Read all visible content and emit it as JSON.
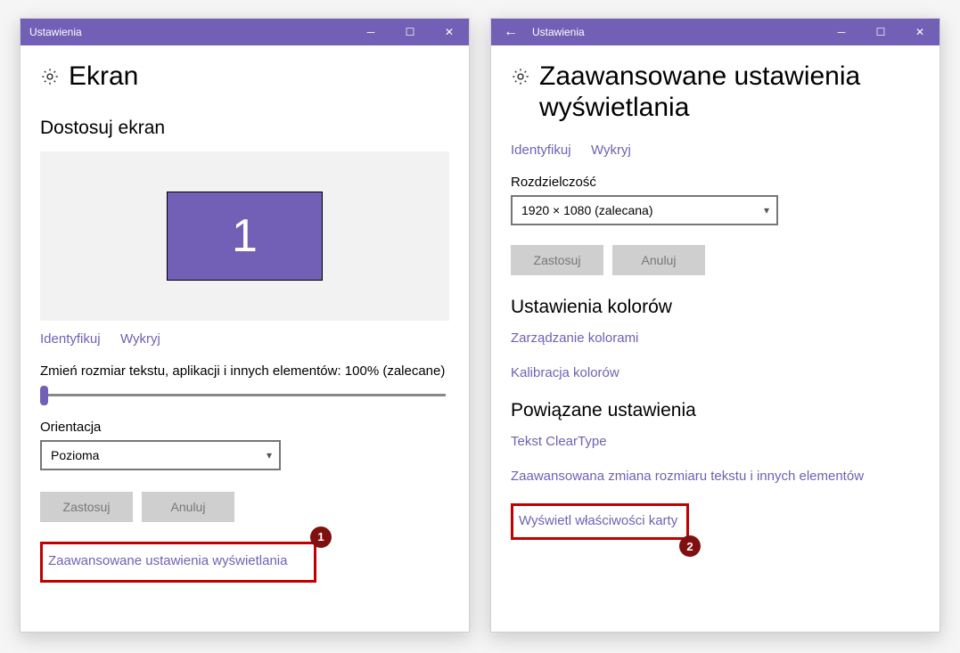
{
  "accent": "#7160b5",
  "left": {
    "titlebar": "Ustawienia",
    "page_title": "Ekran",
    "subhead": "Dostosuj ekran",
    "monitor_number": "1",
    "identify": "Identyfikuj",
    "detect": "Wykryj",
    "scale_text": "Zmień rozmiar tekstu, aplikacji i innych elementów: 100% (zalecane)",
    "orientation_label": "Orientacja",
    "orientation_value": "Pozioma",
    "apply": "Zastosuj",
    "cancel": "Anuluj",
    "advanced_link": "Zaawansowane ustawienia wyświetlania",
    "badge1": "1"
  },
  "right": {
    "titlebar": "Ustawienia",
    "page_title": "Zaawansowane ustawienia wyświetlania",
    "identify": "Identyfikuj",
    "detect": "Wykryj",
    "resolution_label": "Rozdzielczość",
    "resolution_value": "1920 × 1080 (zalecana)",
    "apply": "Zastosuj",
    "cancel": "Anuluj",
    "color_head": "Ustawienia kolorów",
    "color_manage": "Zarządzanie kolorami",
    "color_calib": "Kalibracja kolorów",
    "related_head": "Powiązane ustawienia",
    "cleartype": "Tekst ClearType",
    "adv_text_sizing": "Zaawansowana zmiana rozmiaru tekstu i innych elementów",
    "display_adapter": "Wyświetl właściwości karty",
    "badge2": "2"
  }
}
